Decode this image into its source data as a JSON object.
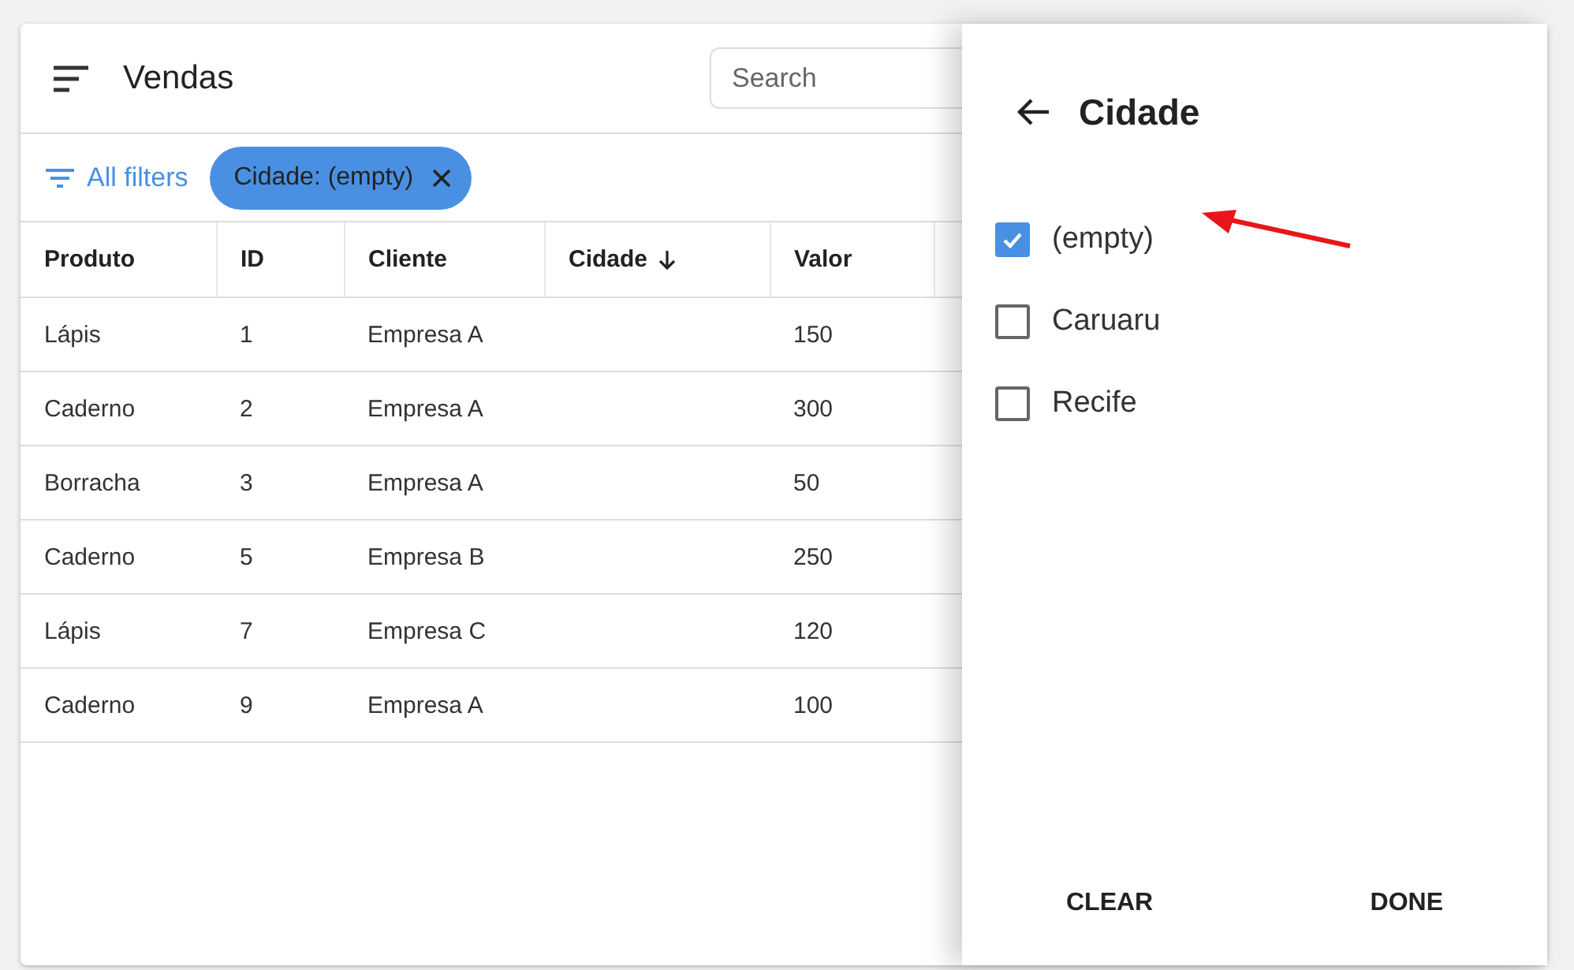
{
  "app_bar": {
    "title": "Vendas",
    "search": {
      "placeholder": "Search"
    }
  },
  "filters": {
    "all_filters": "All filters",
    "chips": [
      {
        "label": "Cidade: (empty)"
      }
    ]
  },
  "table": {
    "columns": [
      {
        "label": "Produto",
        "sorted": false
      },
      {
        "label": "ID",
        "sorted": false
      },
      {
        "label": "Cliente",
        "sorted": false
      },
      {
        "label": "Cidade",
        "sorted": true
      },
      {
        "label": "Valor",
        "sorted": false
      }
    ],
    "rows": [
      [
        "Lápis",
        "1",
        "Empresa A",
        "",
        "150"
      ],
      [
        "Caderno",
        "2",
        "Empresa A",
        "",
        "300"
      ],
      [
        "Borracha",
        "3",
        "Empresa A",
        "",
        "50"
      ],
      [
        "Caderno",
        "5",
        "Empresa B",
        "",
        "250"
      ],
      [
        "Lápis",
        "7",
        "Empresa C",
        "",
        "120"
      ],
      [
        "Caderno",
        "9",
        "Empresa A",
        "",
        "100"
      ]
    ]
  },
  "filter_panel": {
    "title": "Cidade",
    "options": [
      {
        "label": "(empty)",
        "checked": true
      },
      {
        "label": "Caruaru",
        "checked": false
      },
      {
        "label": "Recife",
        "checked": false
      }
    ],
    "buttons": [
      "CLEAR",
      "DONE"
    ]
  }
}
